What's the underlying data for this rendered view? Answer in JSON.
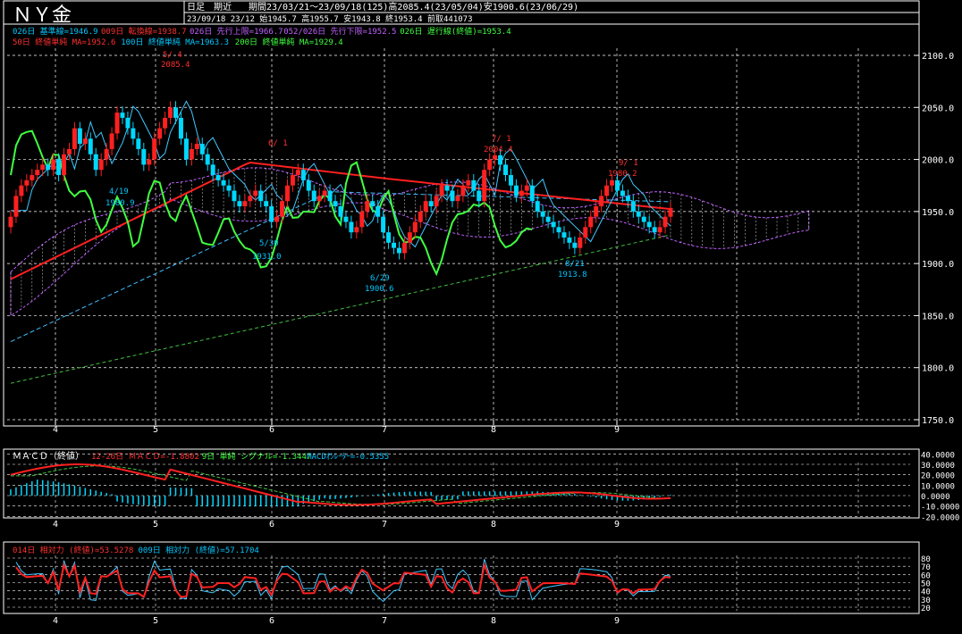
{
  "header": {
    "title": "ＮＹ金",
    "mode": "日足　期近",
    "period_line": "期間23/03/21～23/09/18(125)高2085.4(23/05/04)安1900.6(23/06/29)",
    "ohlc_line": "23/09/18 23/12 始1945.7 高1955.7 安1943.8 終1953.4 前取441073"
  },
  "main_legend": {
    "row1": [
      {
        "text": "026日 基準線=1946.9",
        "color": "#00c8ff"
      },
      {
        "text": "009日 転換線=1938.7",
        "color": "#ff3030"
      },
      {
        "text": "026日 先行上限=1966.7",
        "color": "#c060ff"
      },
      {
        "text": "052/026日 先行下限=1952.5",
        "color": "#c060ff"
      },
      {
        "text": "026日 遅行線(終値)=1953.4",
        "color": "#40ff40"
      }
    ],
    "row2": [
      {
        "text": "50日 終値単純 MA=1952.6",
        "color": "#ff3030"
      },
      {
        "text": "100日 終値単純 MA=1963.3",
        "color": "#00c8ff"
      },
      {
        "text": "200日 終値単純 MA=1929.4",
        "color": "#40ff40"
      }
    ]
  },
  "price_axis": {
    "labels": [
      "2100.0",
      "2050.0",
      "2000.0",
      "1950.0",
      "1900.0",
      "1850.0",
      "1800.0",
      "1750.0"
    ]
  },
  "month_labels": [
    "4",
    "5",
    "6",
    "7",
    "8",
    "9"
  ],
  "annotations": [
    {
      "id": "a1",
      "text": "5/ 4",
      "color": "#ff3030"
    },
    {
      "id": "a2",
      "text": "2085.4",
      "color": "#ff3030"
    },
    {
      "id": "a3",
      "text": "4/19",
      "color": "#00c8ff"
    },
    {
      "id": "a4",
      "text": "1980.9",
      "color": "#00c8ff"
    },
    {
      "id": "a5",
      "text": "6/ 1",
      "color": "#ff3030"
    },
    {
      "id": "a6",
      "text": "5/30",
      "color": "#00c8ff"
    },
    {
      "id": "a7",
      "text": "1931.0",
      "color": "#00c8ff"
    },
    {
      "id": "a8",
      "text": "6/29",
      "color": "#00c8ff"
    },
    {
      "id": "a9",
      "text": "1900.6",
      "color": "#00c8ff"
    },
    {
      "id": "a10",
      "text": "7/ 1",
      "color": "#ff3030"
    },
    {
      "id": "a11",
      "text": "2004.4",
      "color": "#ff3030"
    },
    {
      "id": "a12",
      "text": "8/21",
      "color": "#00c8ff"
    },
    {
      "id": "a13",
      "text": "1913.8",
      "color": "#00c8ff"
    },
    {
      "id": "a14",
      "text": "9/ 1",
      "color": "#ff3030"
    },
    {
      "id": "a15",
      "text": "1980.2",
      "color": "#ff3030"
    }
  ],
  "macd_panel": {
    "title": "ＭＡＣＤ（終値）",
    "legend": [
      {
        "text": "12-26日 ＭＡＣＤ=-1.8802",
        "color": "#ff3030"
      },
      {
        "text": "9日 単純 シグナル=-1.3447",
        "color": "#40ff40"
      },
      {
        "text": "MACDｵｼﾚｰﾀｰ=-0.5355",
        "color": "#00c8ff"
      }
    ],
    "axis_labels": [
      "40.0000",
      "30.0000",
      "20.0000",
      "10.0000",
      "0.0000",
      "-10.0000",
      "-20.0000"
    ]
  },
  "rsi_panel": {
    "legend": [
      {
        "text": "014日 相対力 (終値)=53.5278",
        "color": "#ff3030"
      },
      {
        "text": "009日 相対力 (終値)=57.1704",
        "color": "#00c8ff"
      }
    ],
    "axis_labels": [
      "80",
      "70",
      "60",
      "50",
      "40",
      "30",
      "20"
    ]
  },
  "colors": {
    "up": "#ff2020",
    "down": "#00d8ff",
    "bg": "#000000",
    "grid": "#ffffff",
    "cloud": "#c060ff"
  },
  "chart_data": [
    {
      "type": "candlestick",
      "title": "ＮＹ金",
      "ylim": [
        1750,
        2110
      ],
      "x_range": [
        "2023-03-21",
        "2023-09-18"
      ],
      "month_ticks": [
        "4",
        "5",
        "6",
        "7",
        "8",
        "9"
      ],
      "closes_approx": [
        1945,
        1965,
        1975,
        1980,
        1985,
        1990,
        1995,
        1990,
        2000,
        1985,
        2005,
        2010,
        2030,
        2015,
        2020,
        2005,
        1990,
        2000,
        2010,
        2025,
        2045,
        2040,
        2030,
        2020,
        2010,
        1995,
        2000,
        2020,
        2030,
        2040,
        2050,
        2040,
        2020,
        2000,
        2010,
        2015,
        2005,
        1995,
        1985,
        1980,
        1975,
        1970,
        1960,
        1955,
        1960,
        1965,
        1970,
        1960,
        1955,
        1940,
        1945,
        1960,
        1975,
        1985,
        1990,
        1980,
        1970,
        1960,
        1965,
        1970,
        1960,
        1955,
        1945,
        1940,
        1930,
        1935,
        1950,
        1960,
        1955,
        1945,
        1930,
        1920,
        1915,
        1910,
        1920,
        1930,
        1940,
        1950,
        1960,
        1955,
        1965,
        1975,
        1970,
        1960,
        1965,
        1975,
        1980,
        1970,
        1960,
        1990,
        2000,
        2004,
        1995,
        1985,
        1975,
        1965,
        1970,
        1975,
        1960,
        1950,
        1945,
        1940,
        1935,
        1930,
        1925,
        1920,
        1915,
        1925,
        1935,
        1945,
        1955,
        1965,
        1975,
        1980,
        1970,
        1965,
        1960,
        1950,
        1945,
        1940,
        1935,
        1930,
        1935,
        1945,
        1953.4
      ],
      "series": [
        {
          "name": "026日 基準線",
          "last": 1946.9
        },
        {
          "name": "009日 転換線",
          "last": 1938.7
        },
        {
          "name": "026日 先行上限",
          "last": 1966.7
        },
        {
          "name": "052/026日 先行下限",
          "last": 1952.5
        },
        {
          "name": "026日 遅行線(終値)",
          "last": 1953.4
        },
        {
          "name": "50日 終値単純 MA",
          "last": 1952.6
        },
        {
          "name": "100日 終値単純 MA",
          "last": 1963.3
        },
        {
          "name": "200日 終値単純 MA",
          "last": 1929.4
        }
      ]
    },
    {
      "type": "line",
      "title": "ＭＡＣＤ（終値）",
      "ylim": [
        -20,
        40
      ],
      "series": [
        {
          "name": "12-26日 ＭＡＣＤ",
          "last": -1.8802
        },
        {
          "name": "9日 単純 シグナル",
          "last": -1.3447
        },
        {
          "name": "MACDｵｼﾚｰﾀｰ",
          "last": -0.5355
        }
      ]
    },
    {
      "type": "line",
      "title": "",
      "ylim": [
        20,
        80
      ],
      "series": [
        {
          "name": "014日 相対力 (終値)",
          "last": 53.5278
        },
        {
          "name": "009日 相対力 (終値)",
          "last": 57.1704
        }
      ]
    }
  ]
}
